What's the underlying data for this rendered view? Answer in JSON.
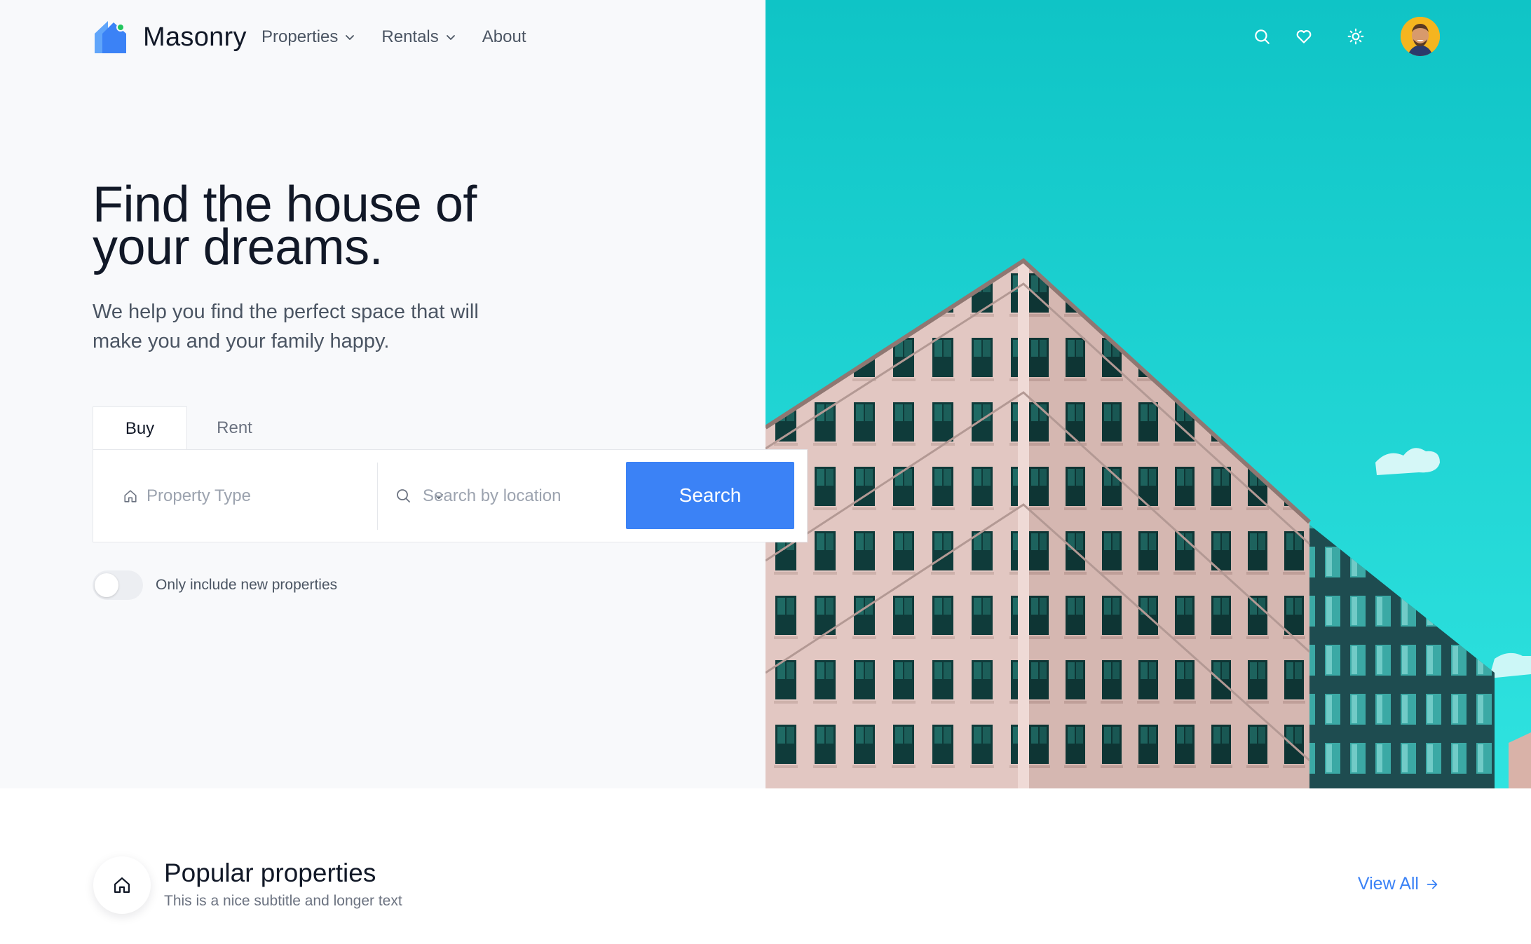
{
  "brand": {
    "name": "Masonry",
    "accent": "#3b82f6"
  },
  "nav": {
    "links": [
      {
        "label": "Properties",
        "has_dropdown": true
      },
      {
        "label": "Rentals",
        "has_dropdown": true
      },
      {
        "label": "About",
        "has_dropdown": false
      }
    ],
    "icons": [
      "search-icon",
      "heart-icon",
      "sun-icon"
    ],
    "avatar": "user-avatar"
  },
  "hero": {
    "title": "Find the house of your dreams.",
    "subtitle": "We help you find the perfect space that will make you and your family happy.",
    "image": "building-photo",
    "sky_color": "#13c9cb"
  },
  "search": {
    "tabs": [
      {
        "label": "Buy",
        "active": true
      },
      {
        "label": "Rent",
        "active": false
      }
    ],
    "property_type_placeholder": "Property Type",
    "location_placeholder": "Search by location",
    "location_value": "",
    "button_label": "Search",
    "toggle_label": "Only include new properties",
    "toggle_on": false
  },
  "popular": {
    "title": "Popular properties",
    "subtitle": "This is a nice subtitle and longer text",
    "view_all_label": "View All"
  }
}
